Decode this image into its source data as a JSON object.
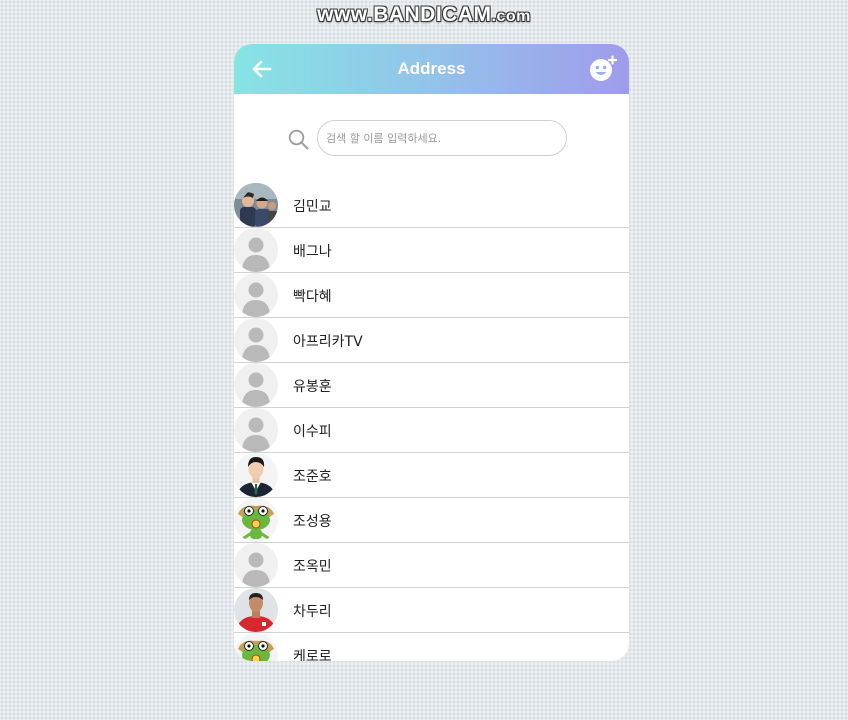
{
  "watermark": {
    "prefix": "www.",
    "brand": "BANDICAM",
    "suffix": ".com"
  },
  "header": {
    "title": "Address",
    "back_icon": "arrow-left-icon",
    "add_icon": "smiley-plus-icon",
    "gradient_start": "#86e4e3",
    "gradient_end": "#a09bec"
  },
  "search": {
    "placeholder": "검색 할 이름 입력하세요.",
    "value": "",
    "icon": "search-icon"
  },
  "contacts": [
    {
      "name": "김민교",
      "avatar": "group-photo"
    },
    {
      "name": "배그나",
      "avatar": "default-person"
    },
    {
      "name": "빡다혜",
      "avatar": "default-person"
    },
    {
      "name": "아프리카TV",
      "avatar": "default-person"
    },
    {
      "name": "유봉훈",
      "avatar": "default-person"
    },
    {
      "name": "이수피",
      "avatar": "default-person"
    },
    {
      "name": "조준호",
      "avatar": "suit-photo"
    },
    {
      "name": "조성용",
      "avatar": "frog-character"
    },
    {
      "name": "조옥민",
      "avatar": "default-person"
    },
    {
      "name": "차두리",
      "avatar": "red-jersey-photo"
    },
    {
      "name": "케로로",
      "avatar": "frog-character"
    }
  ]
}
